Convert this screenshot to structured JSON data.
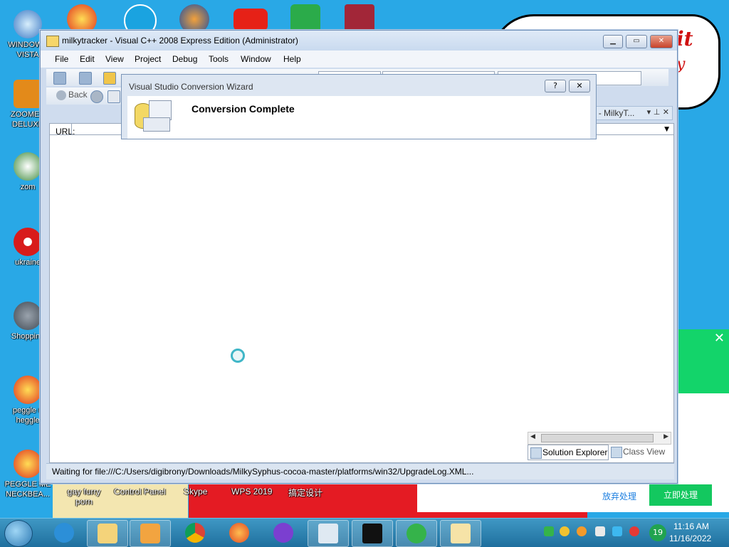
{
  "desktop": {
    "icons": [
      {
        "label": "WINDOWS VISTA"
      },
      {
        "label": "ZOOMER DELUXE"
      },
      {
        "label": "zom"
      },
      {
        "label": "ukraine"
      },
      {
        "label": "Shopping"
      },
      {
        "label": "peggle n heggle"
      },
      {
        "label": "PEGGLE ME NECKBEA..."
      }
    ],
    "bottom_labels": [
      "gay furry porn",
      "Control Panel",
      "Skype",
      "WPS 2019",
      "搞定设计"
    ]
  },
  "window": {
    "title": "milkytracker - Visual C++ 2008 Express Edition (Administrator)",
    "menu": [
      "File",
      "Edit",
      "View",
      "Project",
      "Debug",
      "Tools",
      "Window",
      "Help"
    ],
    "nav": {
      "back_label": "Back"
    },
    "url_label": "URL:",
    "status": "Waiting for file:///C:/Users/digibrony/Downloads/MilkySyphus-cocoa-master/platforms/win32/UpgradeLog.XML..."
  },
  "solution_explorer": {
    "title": "Solution Explorer - MilkyT...",
    "tabs": [
      "Solution Explorer",
      "Class View"
    ]
  },
  "wizard": {
    "title": "Visual Studio Conversion Wizard",
    "heading": "Conversion Complete",
    "help_glyph": "?",
    "close_glyph": "✕"
  },
  "notification": {
    "ignore_label": "放弃处理",
    "action_label": "立即处理",
    "close_glyph": "✕"
  },
  "taskbar": {
    "apps": [
      "internet-explorer",
      "file-explorer",
      "media-player",
      "chrome",
      "firefox",
      "app",
      "notepad",
      "7zip",
      "green-plus",
      "vs"
    ],
    "tray_badge": "19",
    "time": "11:16 AM",
    "date": "11/16/2022"
  }
}
